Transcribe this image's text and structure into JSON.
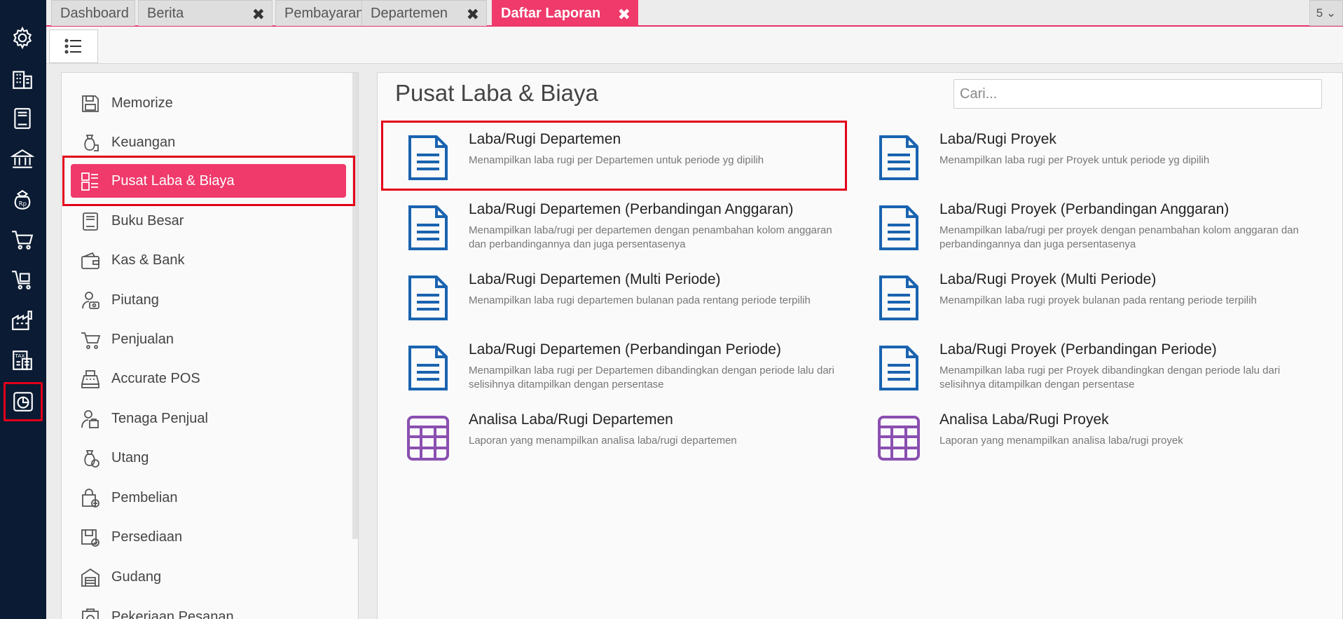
{
  "tabs": [
    {
      "label": "Dashboard",
      "closable": false
    },
    {
      "label": "Berita",
      "closable": true
    },
    {
      "label": "Pembayaran",
      "closable": true
    },
    {
      "label": "Departemen",
      "closable": true
    },
    {
      "label": "Daftar Laporan",
      "closable": true,
      "active": true
    }
  ],
  "tab_close_glyph": "✖",
  "tab_count": "5 ⌄",
  "sidebar": {
    "items": [
      {
        "label": "Memorize",
        "icon": "floppy-icon"
      },
      {
        "label": "Keuangan",
        "icon": "money-bag-icon"
      },
      {
        "label": "Pusat Laba & Biaya",
        "icon": "cost-center-icon",
        "active": true
      },
      {
        "label": "Buku Besar",
        "icon": "ledger-icon"
      },
      {
        "label": "Kas & Bank",
        "icon": "wallet-icon"
      },
      {
        "label": "Piutang",
        "icon": "receivable-icon"
      },
      {
        "label": "Penjualan",
        "icon": "cart-icon"
      },
      {
        "label": "Accurate POS",
        "icon": "cash-register-icon"
      },
      {
        "label": "Tenaga Penjual",
        "icon": "salesperson-icon"
      },
      {
        "label": "Utang",
        "icon": "debt-icon"
      },
      {
        "label": "Pembelian",
        "icon": "shopping-bag-icon"
      },
      {
        "label": "Persediaan",
        "icon": "inventory-icon"
      },
      {
        "label": "Gudang",
        "icon": "warehouse-icon"
      },
      {
        "label": "Pekerjaan Pesanan",
        "icon": "job-order-icon"
      }
    ]
  },
  "main": {
    "title": "Pusat Laba & Biaya",
    "search_placeholder": "Cari...",
    "reports": [
      {
        "title": "Laba/Rugi Departemen",
        "desc": "Menampilkan laba rugi per Departemen untuk periode yg dipilih",
        "icon": "document-icon"
      },
      {
        "title": "Laba/Rugi Proyek",
        "desc": "Menampilkan laba rugi per Proyek untuk periode yg dipilih",
        "icon": "document-icon"
      },
      {
        "title": "Laba/Rugi Departemen (Perbandingan Anggaran)",
        "desc": "Menampilkan laba/rugi per departemen dengan penambahan kolom anggaran dan perbandingannya dan juga persentasenya",
        "icon": "document-icon"
      },
      {
        "title": "Laba/Rugi Proyek (Perbandingan Anggaran)",
        "desc": "Menampilkan laba/rugi per proyek dengan penambahan kolom anggaran dan perbandingannya dan juga persentasenya",
        "icon": "document-icon"
      },
      {
        "title": "Laba/Rugi Departemen (Multi Periode)",
        "desc": "Menampilkan laba rugi departemen bulanan pada rentang periode terpilih",
        "icon": "document-icon"
      },
      {
        "title": "Laba/Rugi Proyek (Multi Periode)",
        "desc": "Menampilkan laba rugi proyek bulanan pada rentang periode terpilih",
        "icon": "document-icon"
      },
      {
        "title": "Laba/Rugi Departemen (Perbandingan Periode)",
        "desc": "Menampilkan laba rugi per Departemen dibandingkan dengan periode lalu dari selisihnya ditampilkan dengan persentase",
        "icon": "document-icon"
      },
      {
        "title": "Laba/Rugi Proyek (Perbandingan Periode)",
        "desc": "Menampilkan laba rugi per Proyek dibandingkan dengan periode lalu dari selisihnya ditampilkan dengan persentase",
        "icon": "document-icon"
      },
      {
        "title": "Analisa Laba/Rugi Departemen",
        "desc": "Laporan yang menampilkan analisa laba/rugi departemen",
        "icon": "grid-table-icon"
      },
      {
        "title": "Analisa Laba/Rugi Proyek",
        "desc": "Laporan yang menampilkan analisa laba/rugi proyek",
        "icon": "grid-table-icon"
      }
    ]
  },
  "rail": {
    "items": [
      {
        "icon": "gear-icon"
      },
      {
        "icon": "building-icon"
      },
      {
        "icon": "book-icon"
      },
      {
        "icon": "bank-icon"
      },
      {
        "icon": "rupiah-bag-icon"
      },
      {
        "icon": "cart-icon"
      },
      {
        "icon": "cart-box-icon"
      },
      {
        "icon": "factory-icon"
      },
      {
        "icon": "tax-icon"
      },
      {
        "icon": "report-chart-icon",
        "active": true
      }
    ]
  },
  "colors": {
    "accent": "#ef3a6b",
    "rail": "#0b1b33",
    "doc_icon": "#1a63b0",
    "grid_icon": "#8a4fb0",
    "highlight": "#e2001a"
  }
}
